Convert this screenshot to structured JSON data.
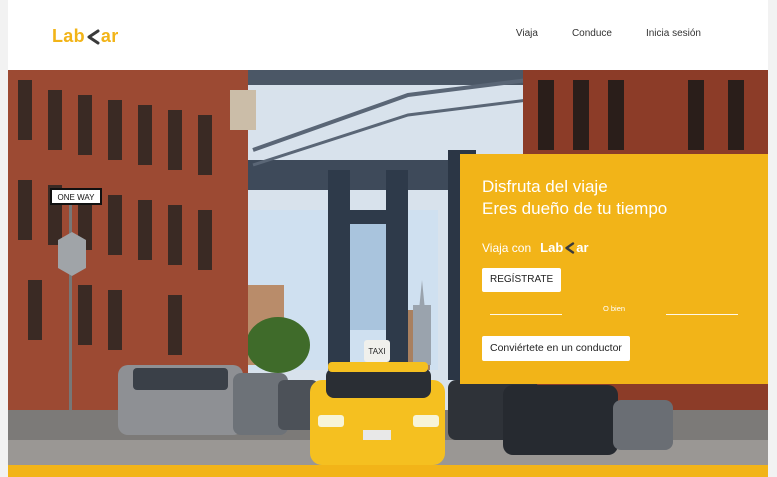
{
  "brand": {
    "name_left": "Lab",
    "name_right": "ar",
    "accent": "#f2b418",
    "logo_icon": "chevron-left-icon"
  },
  "nav": {
    "items": [
      {
        "label": "Viaja"
      },
      {
        "label": "Conduce"
      },
      {
        "label": "Inicia sesión"
      }
    ]
  },
  "hero": {
    "image": "city-street-bridge-taxi-photo",
    "sign_text": "ONE WAY",
    "taxi_sign": "TAXI"
  },
  "panel": {
    "headline_1": "Disfruta del viaje",
    "headline_2": "Eres dueño de tu tiempo",
    "ride_with": "Viaja con",
    "register_label": "REGÍSTRATE",
    "or_label": "O bien",
    "driver_label": "Conviértete en un conductor"
  }
}
